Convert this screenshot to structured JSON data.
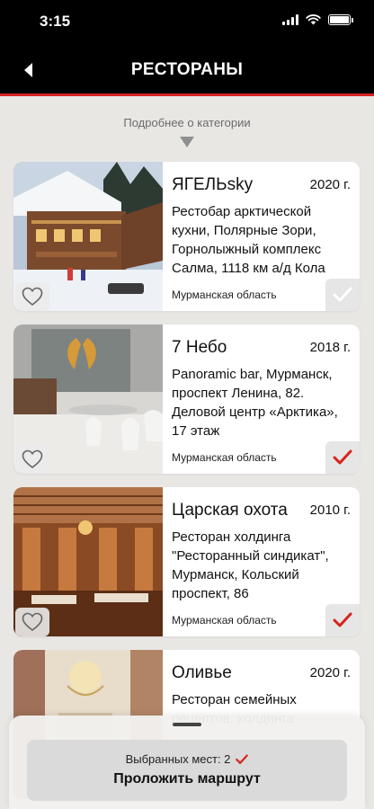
{
  "status_bar": {
    "time": "3:15"
  },
  "nav": {
    "title": "РЕСТОРАНЫ"
  },
  "category": {
    "more_label": "Подробнее о категории"
  },
  "restaurants": [
    {
      "name": "ЯГЕЛЬsky",
      "year": "2020 г.",
      "description": "Рестобар арктической кухни, Полярные Зори, Горнолыжный комплекс Салма, 1118 км а/д Кола",
      "region": "Мурманская область",
      "selected": false,
      "photo": "snowy wooden chalet"
    },
    {
      "name": "7 Небо",
      "year": "2018 г.",
      "description": "Panoramic bar, Мурманск, проспект Ленина, 82. Деловой центр «Арктика», 17 этаж",
      "region": "Мурманская область",
      "selected": true,
      "photo": "restaurant interior with golden wings"
    },
    {
      "name": "Царская охота",
      "year": "2010 г.",
      "description": "Ресторан холдинга \"Ресторанный синдикат\", Мурманск, Кольский проспект, 86",
      "region": "Мурманская область",
      "selected": true,
      "photo": "wooden restaurant hall"
    },
    {
      "name": "Оливье",
      "year": "2020 г.",
      "description": "Ресторан семейных рецептов, холдинга",
      "region": "",
      "selected": false,
      "photo": "chandelier interior"
    }
  ],
  "route": {
    "selected_label": "Выбранных мест: 2",
    "button_label": "Проложить маршрут"
  },
  "colors": {
    "accent": "#d8231f",
    "nav_bg": "#000000",
    "background": "#e9e7e4"
  }
}
